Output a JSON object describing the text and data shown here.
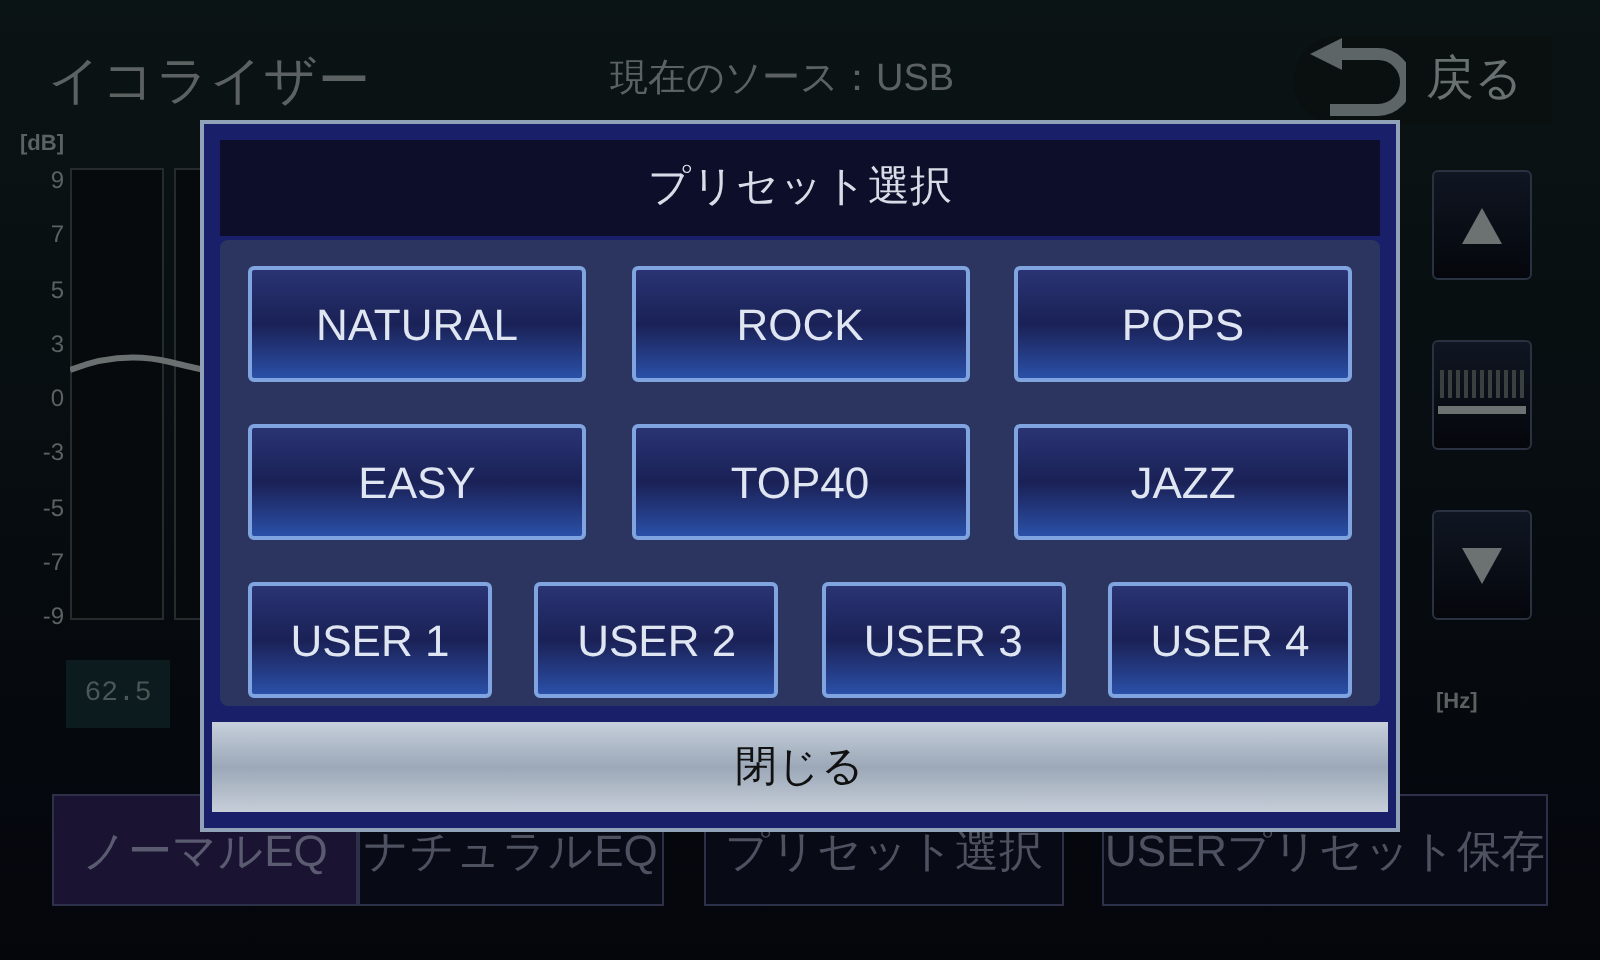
{
  "screen": {
    "title": "イコライザー",
    "source": "現在のソース：USB",
    "back_button": "戻る"
  },
  "graph": {
    "y_unit": "[dB]",
    "y_labels": [
      "9",
      "7",
      "5",
      "3",
      "0",
      "-3",
      "-5",
      "-7",
      "-9"
    ],
    "x_labels": [
      "62.5"
    ],
    "x_unit": "[Hz]"
  },
  "side_buttons": [
    {
      "kind": "up"
    },
    {
      "kind": "handle"
    },
    {
      "kind": "down"
    }
  ],
  "mode_tabs": [
    {
      "label": "ノーマルEQ",
      "selected": true
    },
    {
      "label": "ナチュラルEQ",
      "selected": false
    }
  ],
  "buttons": [
    "プリセット選択",
    "USERプリセット保存"
  ],
  "dialog": {
    "title": "プリセット選択",
    "rows": [
      [
        "NATURAL",
        "ROCK",
        "POPS"
      ],
      [
        "EASY",
        "TOP40",
        "JAZZ"
      ],
      [
        "USER 1",
        "USER 2",
        "USER 3",
        "USER 4"
      ]
    ],
    "close_button": "閉じる"
  }
}
